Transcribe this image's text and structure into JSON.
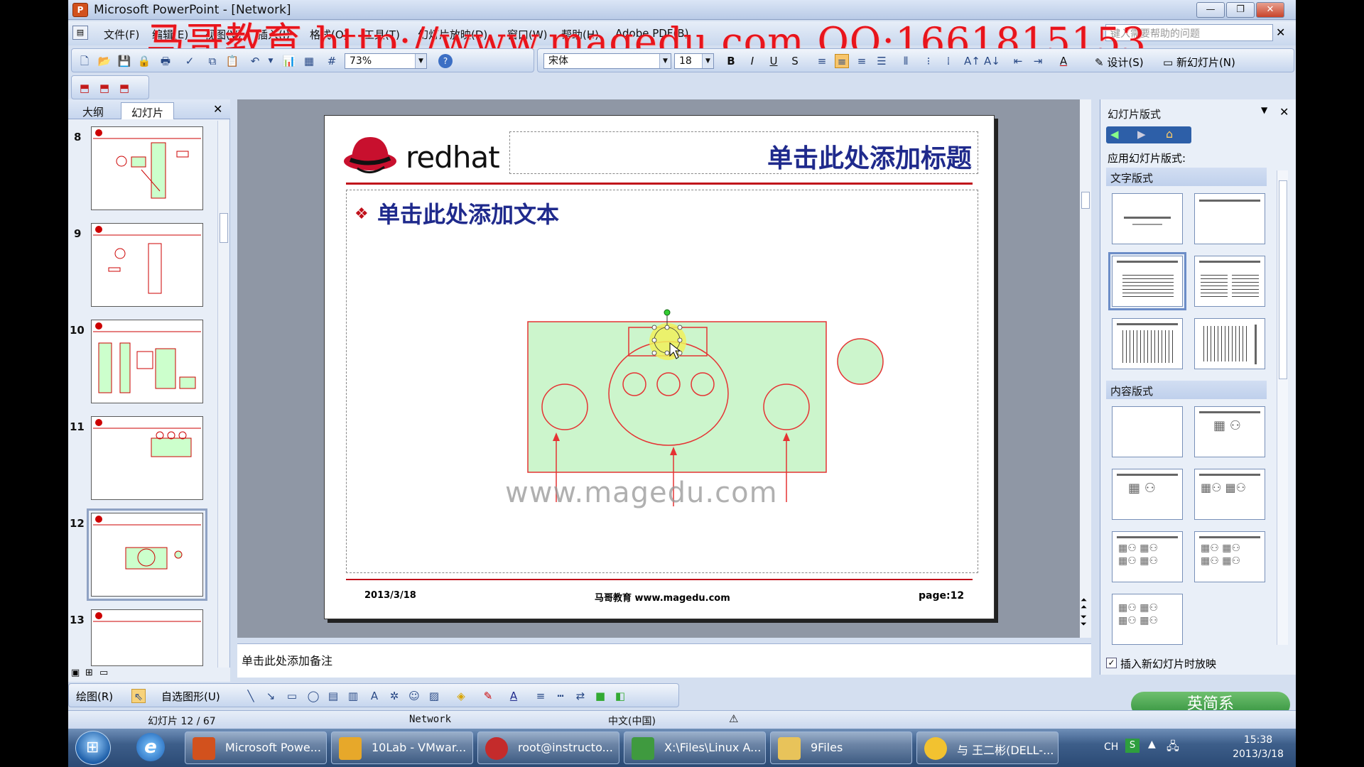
{
  "window": {
    "title": "Microsoft PowerPoint - [Network]"
  },
  "watermark": "马哥教育 http://www.magedu.com QQ:1661815153",
  "menu": {
    "items": [
      "文件(F)",
      "编辑(E)",
      "视图(V)",
      "插入(I)",
      "格式(O)",
      "工具(T)",
      "幻灯片放映(D)",
      "窗口(W)",
      "帮助(H)",
      "Adobe PDF(B)"
    ],
    "help_placeholder": "键入需要帮助的问题"
  },
  "toolbar": {
    "zoom": "73%",
    "font": "宋体",
    "font_size": "18",
    "design_label": "设计(S)",
    "new_slide_label": "新幻灯片(N)"
  },
  "left_panel": {
    "tabs": [
      "大纲",
      "幻灯片"
    ],
    "active_tab": "幻灯片",
    "slides": [
      "8",
      "9",
      "10",
      "11",
      "12",
      "13"
    ],
    "selected": "12"
  },
  "slide": {
    "logo_text": "redhat",
    "title": "单击此处添加标题",
    "body": "单击此处添加文本",
    "watermark": "www.magedu.com",
    "footer_date": "2013/3/18",
    "footer_center": "马哥教育 www.magedu.com",
    "footer_page_label": "page:",
    "footer_page": "12",
    "colors": {
      "accent": "#c0101a",
      "fill": "#ccf5cc",
      "title": "#1f2a8c"
    }
  },
  "notes": {
    "text": "单击此处添加备注"
  },
  "task_pane": {
    "title": "幻灯片版式",
    "apply_label": "应用幻灯片版式:",
    "section_text": "文字版式",
    "section_content": "内容版式",
    "checkbox_label": "插入新幻灯片时放映",
    "checkbox_checked": true
  },
  "drawing_bar": {
    "draw_label": "绘图(R)",
    "autoshape_label": "自选图形(U)"
  },
  "status": {
    "slide_info": "幻灯片 12 / 67",
    "template": "Network",
    "language": "中文(中国)"
  },
  "ime": {
    "label": "英简系"
  },
  "taskbar": {
    "items": [
      "Microsoft Powe...",
      "10Lab - VMwar...",
      "root@instructo...",
      "X:\\Files\\Linux A...",
      "9Files",
      "与 王二彬(DELL-..."
    ],
    "lang": "CH",
    "time": "15:38",
    "date": "2013/3/18"
  }
}
